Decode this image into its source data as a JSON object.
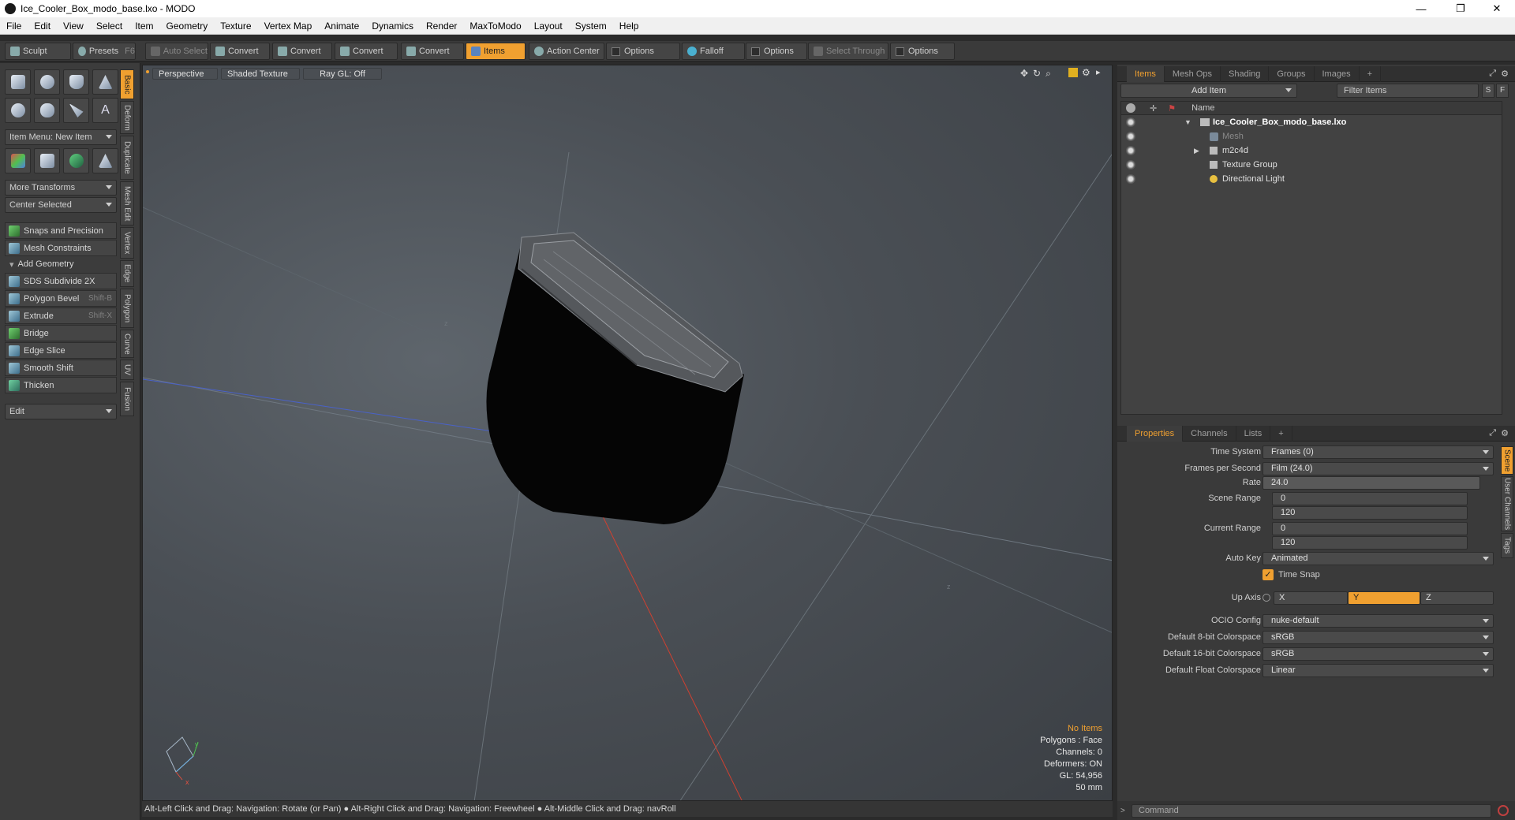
{
  "window": {
    "title": "Ice_Cooler_Box_modo_base.lxo - MODO",
    "minimize": "—",
    "restore": "❐",
    "close": "✕"
  },
  "menu": [
    "File",
    "Edit",
    "View",
    "Select",
    "Item",
    "Geometry",
    "Texture",
    "Vertex Map",
    "Animate",
    "Dynamics",
    "Render",
    "MaxToModo",
    "Layout",
    "System",
    "Help"
  ],
  "toolbar": {
    "sculpt": "Sculpt",
    "presets": "Presets",
    "presets_key": "F6",
    "auto_select": "Auto Select",
    "convert1": "Convert",
    "convert2": "Convert",
    "convert3": "Convert",
    "convert4": "Convert",
    "items": "Items",
    "action_center": "Action Center",
    "options1": "Options",
    "falloff": "Falloff",
    "options2": "Options",
    "select_through": "Select Through",
    "options3": "Options"
  },
  "left": {
    "item_menu": "Item Menu: New Item",
    "more_transforms": "More Transforms",
    "center_selected": "Center Selected",
    "snaps": "Snaps and Precision",
    "mesh_constraints": "Mesh Constraints",
    "add_geometry": "Add Geometry",
    "tools": [
      {
        "label": "SDS Subdivide 2X",
        "key": ""
      },
      {
        "label": "Polygon Bevel",
        "key": "Shift-B"
      },
      {
        "label": "Extrude",
        "key": "Shift-X"
      },
      {
        "label": "Bridge",
        "key": ""
      },
      {
        "label": "Edge Slice",
        "key": ""
      },
      {
        "label": "Smooth Shift",
        "key": ""
      },
      {
        "label": "Thicken",
        "key": ""
      }
    ],
    "edit": "Edit",
    "vtabs": [
      "Basic",
      "Deform",
      "Duplicate",
      "Mesh Edit",
      "Vertex",
      "Edge",
      "Polygon",
      "Curve",
      "UV",
      "Fusion"
    ]
  },
  "viewport": {
    "perspective": "Perspective",
    "shading": "Shaded Texture",
    "raygl": "Ray GL: Off",
    "hud": {
      "items": "No Items",
      "polygons": "Polygons : Face",
      "channels": "Channels: 0",
      "deformers": "Deformers: ON",
      "gl": "GL: 54,956",
      "size": "50 mm"
    }
  },
  "status": "Alt-Left Click and Drag: Navigation: Rotate (or Pan) ● Alt-Right Click and Drag: Navigation: Freewheel ● Alt-Middle Click and Drag: navRoll",
  "items_panel": {
    "tabs": [
      "Items",
      "Mesh Ops",
      "Shading",
      "Groups",
      "Images",
      "+"
    ],
    "add_item": "Add Item",
    "filter": "Filter Items",
    "s": "S",
    "f": "F",
    "col_name": "Name",
    "rows": [
      {
        "label": "Ice_Cooler_Box_modo_base.lxo",
        "expander": "▼"
      },
      {
        "label": "Mesh",
        "expander": ""
      },
      {
        "label": "m2c4d",
        "expander": "▶"
      },
      {
        "label": "Texture Group",
        "expander": ""
      },
      {
        "label": "Directional Light",
        "expander": ""
      }
    ]
  },
  "properties": {
    "tabs": [
      "Properties",
      "Channels",
      "Lists",
      "+"
    ],
    "time_system_label": "Time System",
    "time_system": "Frames (0)",
    "fps_label": "Frames per Second",
    "fps": "Film (24.0)",
    "rate_label": "Rate",
    "rate": "24.0",
    "scene_range_label": "Scene Range",
    "scene_start": "0",
    "scene_end": "120",
    "current_range_label": "Current Range",
    "current_start": "0",
    "current_end": "120",
    "auto_key_label": "Auto Key",
    "auto_key": "Animated",
    "time_snap": "Time Snap",
    "up_axis_label": "Up Axis",
    "up_x": "X",
    "up_y": "Y",
    "up_z": "Z",
    "ocio_label": "OCIO Config",
    "ocio": "nuke-default",
    "cs8_label": "Default 8-bit Colorspace",
    "cs8": "sRGB",
    "cs16_label": "Default 16-bit Colorspace",
    "cs16": "sRGB",
    "csf_label": "Default Float Colorspace",
    "csf": "Linear",
    "vtabs": [
      "Scene",
      "User Channels",
      "Tags"
    ]
  },
  "command": {
    "placeholder": "Command"
  },
  "colors": {
    "accent": "#f0a030"
  }
}
